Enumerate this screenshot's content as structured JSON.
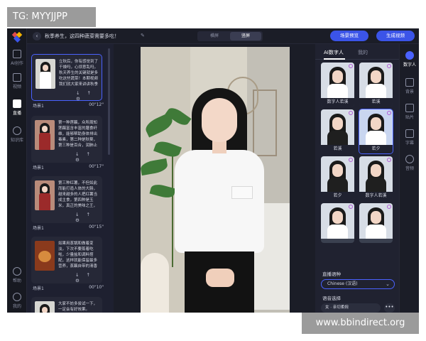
{
  "watermarks": {
    "top_left": "TG: MYYJJPP",
    "bottom_right": "www.bbindirect.org"
  },
  "topbar": {
    "back": "‹",
    "title": "秋季养生，这四种蔬菜需要多吃！",
    "edit": "✎",
    "orientation": {
      "landscape": "横屏",
      "portrait": "竖屏",
      "selected": "portrait"
    },
    "preview_label": "场景预览",
    "generate_label": "生成视频"
  },
  "left_nav": [
    {
      "label": "AI创作",
      "icon": "ai-create-icon"
    },
    {
      "label": "视频",
      "icon": "video-icon"
    },
    {
      "label": "直播",
      "icon": "live-icon",
      "active": true
    },
    {
      "label": "知识库",
      "icon": "knowledge-icon"
    },
    {
      "label": "帮助",
      "icon": "help-icon"
    },
    {
      "label": "我的",
      "icon": "profile-icon"
    }
  ],
  "scenes": [
    {
      "text": "立秋后，你有感觉到了干燥吗，心烦意乱吗，秋天养生的关键就是多吃这些蔬菜！本期视频我们就大家来讲讲秋季养生应该吃的蔬菜，对抗秋燥。",
      "name": "场景1",
      "time": "00\"12\"",
      "thumb": "white"
    },
    {
      "text": "第一种莲藕，众所周知莲藕富含丰富的膳食纤维，能够帮助身体排出毒素，第二种是秋葵，第三种是百合，润肺止咳，第四种是山药。",
      "name": "场景1",
      "time": "00\"17\"",
      "thumb": "red"
    },
    {
      "text": "第三种红薯，不但如此而能打造人体的大肠，越来越多的人把红薯当成主食，第四种是玉米，真正的美味之王，特别推荐大家。",
      "name": "场景1",
      "time": "00\"15\"",
      "thumb": "red"
    },
    {
      "text": "如果用蒸锅和做着变淡，下次不要蒸着吃啦，少量盐和调料搭配，这样就能保留最多营养，蒸藕自带的清香回味无穷。",
      "name": "场景1",
      "time": "00\"10\"",
      "thumb": "food"
    },
    {
      "text": "大家不妨多尝试一下，一定会有好效果。",
      "name": "",
      "time": "",
      "thumb": "white"
    }
  ],
  "card_icons": "↓ ↑ ⚙",
  "right_panel": {
    "tabs": {
      "ai_avatar": "AI数字人",
      "mine": "我的"
    },
    "avatars": [
      {
        "label": "数字人若溪",
        "style": "white"
      },
      {
        "label": "若溪",
        "style": "white"
      },
      {
        "label": "若溪",
        "style": "black"
      },
      {
        "label": "若夕",
        "style": "white",
        "selected": true
      },
      {
        "label": "若夕",
        "style": "black"
      },
      {
        "label": "数字人若溪",
        "style": "black"
      },
      {
        "label": "",
        "style": "white"
      },
      {
        "label": "",
        "style": "white"
      }
    ],
    "live_lang_label": "直播语种",
    "live_lang_value": "Chinese (汉语)",
    "voice_label": "语音选择",
    "voice_value": "女 · 亲切柔婉",
    "more": "•••"
  },
  "right_tools": [
    {
      "label": "数字人",
      "icon": "avatar-icon",
      "active": true
    },
    {
      "label": "背景",
      "icon": "background-icon"
    },
    {
      "label": "贴片",
      "icon": "overlay-icon"
    },
    {
      "label": "字幕",
      "icon": "subtitle-icon"
    },
    {
      "label": "音频",
      "icon": "audio-icon"
    }
  ]
}
